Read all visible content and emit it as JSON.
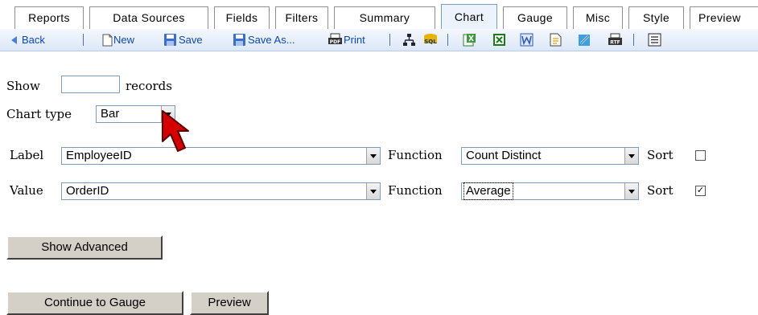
{
  "tabs": [
    {
      "label": "Reports"
    },
    {
      "label": "Data Sources"
    },
    {
      "label": "Fields"
    },
    {
      "label": "Filters"
    },
    {
      "label": "Summary"
    },
    {
      "label": "Chart",
      "active": true
    },
    {
      "label": "Gauge"
    },
    {
      "label": "Misc"
    },
    {
      "label": "Style"
    },
    {
      "label": "Preview"
    }
  ],
  "toolbar": {
    "back_label": "Back",
    "new_label": "New",
    "save_label": "Save",
    "save_as_label": "Save As...",
    "print_label": "Print",
    "sql_icon_text": "SQL",
    "rtf_icon_text": "RTF",
    "icons": [
      "back-icon",
      "new-icon",
      "save-icon",
      "save-as-icon",
      "print-pdf-icon",
      "hierarchy-icon",
      "sql-icon",
      "excel-icon",
      "excel-xls-icon",
      "word-icon",
      "document-icon",
      "edit-icon",
      "rtf-icon",
      "list-icon"
    ]
  },
  "form": {
    "show_label": "Show",
    "records_label": "records",
    "show_value": "",
    "chart_type_label": "Chart type",
    "chart_type_value": "Bar",
    "label_label": "Label",
    "label_field_value": "EmployeeID",
    "label_function_label": "Function",
    "label_function_value": "Count Distinct",
    "label_sort_label": "Sort",
    "label_sort_checked": false,
    "value_label": "Value",
    "value_field_value": "OrderID",
    "value_function_label": "Function",
    "value_function_value": "Average",
    "value_sort_label": "Sort",
    "value_sort_checked": true,
    "check_mark": "✓"
  },
  "buttons": {
    "show_advanced": "Show Advanced",
    "continue_to_gauge": "Continue to Gauge",
    "preview": "Preview"
  },
  "colors": {
    "toolbar_text": "#0b47b0",
    "tab_active_bg": "#ecf3fd",
    "button_face": "#d4d0c8",
    "cursor": "#cc0000"
  }
}
